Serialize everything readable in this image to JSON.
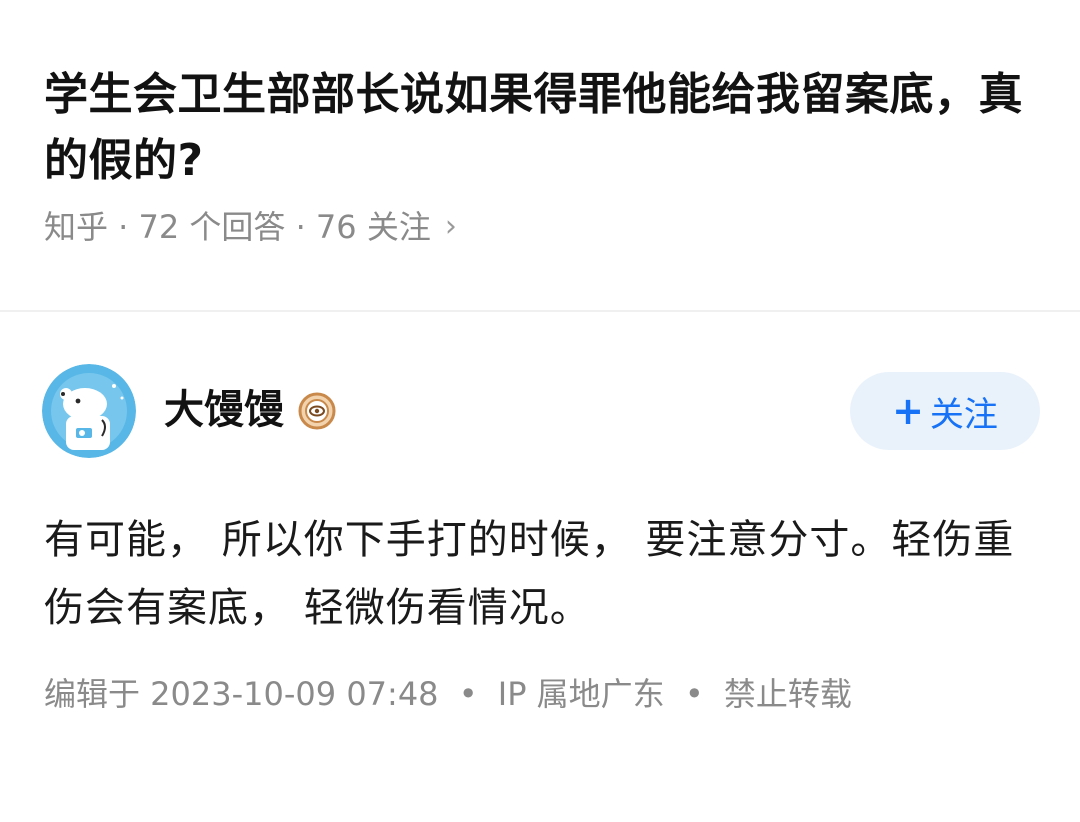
{
  "question": {
    "title": "学生会卫生部部长说如果得罪他能给我留案底，真的假的?",
    "meta": "知乎 · 72 个回答 · 76 关注",
    "chevron": "›"
  },
  "answer": {
    "author": {
      "name": "大馒馒",
      "avatar_icon": "polar-bear-astronaut-avatar",
      "badge_icon": "eye-badge-icon"
    },
    "follow_button": {
      "plus": "+",
      "label": "关注"
    },
    "content": "有可能， 所以你下手打的时候， 要注意分寸。轻伤重伤会有案底， 轻微伤看情况。",
    "meta": {
      "edited": "编辑于 2023-10-09 07:48",
      "ip": "IP 属地广东",
      "copyright": "禁止转载",
      "separator": "•"
    }
  },
  "colors": {
    "accent": "#1772f6",
    "follow_bg": "#e9f2fb",
    "meta_text": "#8a8a8a",
    "badge": "#c8894a",
    "avatar_bg": "#58b7e6"
  }
}
